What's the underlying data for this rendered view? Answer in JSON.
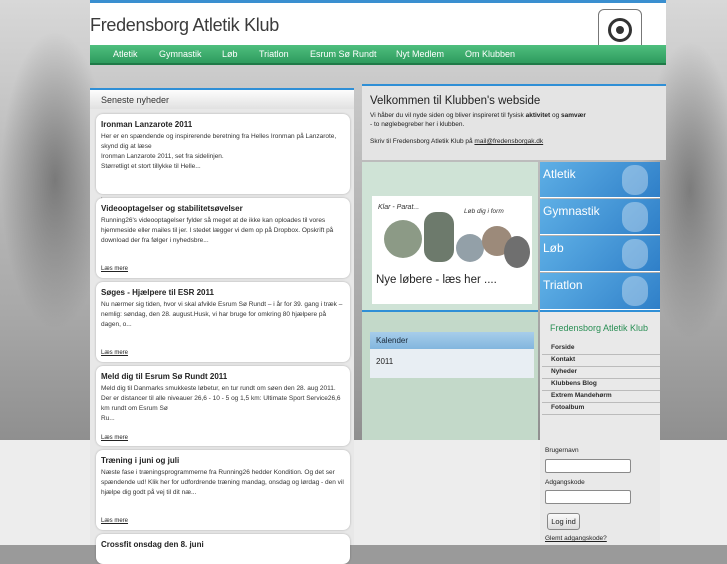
{
  "site": {
    "title": "Fredensborg Atletik Klub"
  },
  "nav": [
    "Atletik",
    "Gymnastik",
    "Løb",
    "Triatlon",
    "Esrum Sø Rundt",
    "Nyt Medlem",
    "Om Klubben"
  ],
  "news": {
    "heading": "Seneste nyheder",
    "read_more": "Læs mere",
    "items": [
      {
        "title": "Ironman Lanzarote 2011",
        "body": "Her er en spændende og inspirerende beretning fra Helles Ironman på Lanzarote, skynd dig at læse\nIronman Lanzarote 2011, set fra sidelinjen.\nStørretligt et stort tillykke til Helle..."
      },
      {
        "title": "Videooptagelser og stabilitetsøvelser",
        "body": "Running26's videooptagelser fylder så meget at de ikke kan oploades til vores hjemmeside eller mailes til jer. I stedet lægger vi dem op på Dropbox. Opskrift på download der fra følger i nyhedsbre..."
      },
      {
        "title": "Søges - Hjælpere til ESR 2011",
        "body": "Nu nærmer sig tiden, hvor vi skal afvikle Esrum Sø Rundt – i år for 39. gang i træk – nemlig: søndag, den 28. august.Husk, vi har bruge for omkring 80 hjælpere på dagen, o..."
      },
      {
        "title": "Meld dig til Esrum Sø Rundt 2011",
        "body": "Meld dig til Danmarks smukkeste løbetur, en tur rundt om søen den 28. aug 2011. Der er distancer til alle niveauer 26,6 - 10 - 5 og 1,5 km: Ultimate Sport Service26,6 km rundt om Esrum Sø\nRu..."
      },
      {
        "title": "Træning i juni og juli",
        "body": "Næste fase i træningsprogrammerne fra Running26 hedder Kondition. Og det ser spændende ud! Klik her for udfordrende træning mandag, onsdag og lørdag - den vil hjælpe dig godt på vej til dit næ..."
      },
      {
        "title": "Crossfit onsdag den 8. juni",
        "body": ""
      }
    ]
  },
  "welcome": {
    "heading": "Velkommen til Klubben's webside",
    "text_pre": "Vi håber du vil nyde siden og bliver inspireret til fysisk ",
    "text_bold1": "aktivitet",
    "text_mid": " og ",
    "text_bold2": "samvær",
    "text_post": " - to nøglebegreber her i klubben.",
    "contact_pre": "Skriv til Fredensborg Atletik Klub på ",
    "email": "mail@fredensborgak.dk"
  },
  "promo": {
    "slogan_left": "Klar - Parat...",
    "slogan_right": "Løb dig i form",
    "caption": "Nye løbere - læs her ...."
  },
  "calendar": {
    "heading": "Kalender",
    "year": "2011"
  },
  "tiles": [
    "Atletik",
    "Gymnastik",
    "Løb",
    "Triatlon"
  ],
  "club": {
    "title": "Fredensborg Atletik Klub",
    "menu": [
      "Forside",
      "Kontakt",
      "Nyheder",
      "Klubbens Blog",
      "Extrem Mandehørm",
      "Fotoalbum"
    ]
  },
  "login": {
    "username_label": "Brugernavn",
    "password_label": "Adgangskode",
    "button": "Log ind",
    "forgot": "Glemt adgangskode?"
  },
  "colors": {
    "accent": "#2f8fd6",
    "nav_green": "#2e9b5e",
    "club_green": "#2a8f55"
  }
}
